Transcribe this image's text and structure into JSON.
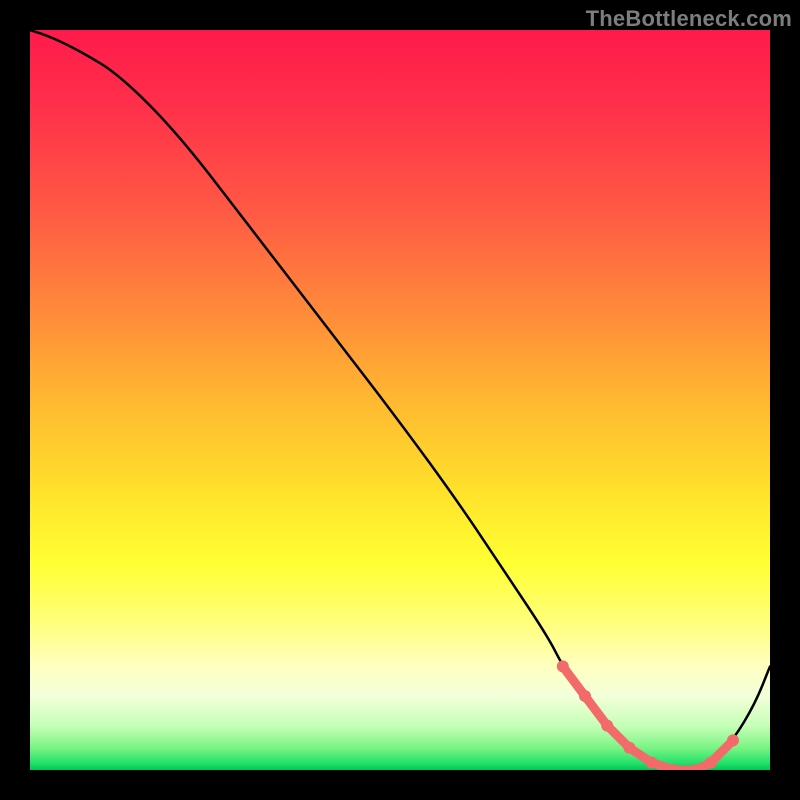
{
  "watermark": "TheBottleneck.com",
  "chart_data": {
    "type": "line",
    "title": "",
    "xlabel": "",
    "ylabel": "",
    "xlim": [
      0,
      100
    ],
    "ylim": [
      0,
      100
    ],
    "x": [
      0,
      3,
      7,
      12,
      20,
      30,
      40,
      50,
      58,
      64,
      70,
      72,
      75,
      78,
      81,
      84,
      87,
      90,
      92,
      95,
      98,
      100
    ],
    "values": [
      100,
      99,
      97,
      94,
      86,
      73,
      60,
      47,
      36,
      27,
      18,
      14,
      10,
      6,
      3,
      1,
      0,
      0,
      1,
      4,
      9,
      14
    ],
    "highlight_indices": [
      11,
      12,
      13,
      14,
      15,
      16,
      17,
      18,
      19
    ],
    "colors": {
      "line": "#000000",
      "accent": "#f36a6a"
    }
  }
}
